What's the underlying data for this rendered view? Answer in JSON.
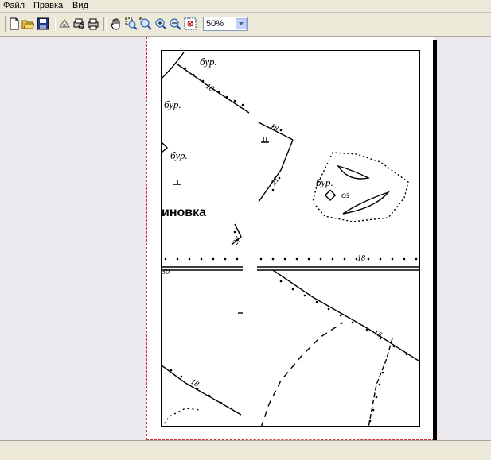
{
  "menu": {
    "file": "Файл",
    "edit": "Правка",
    "view": "Вид"
  },
  "toolbar": {
    "zoom_value": "50%",
    "tools": [
      "new-document-icon",
      "open-folder-icon",
      "save-disk-icon",
      "scan-icon",
      "print-preview-icon",
      "print-icon",
      "pan-hand-icon",
      "zoom-area-icon",
      "zoom-fit-icon",
      "zoom-in-icon",
      "zoom-out-icon",
      "zoom-to-page-icon"
    ]
  },
  "map": {
    "labels": {
      "bur1": "бур.",
      "bur2": "бур.",
      "bur3": "бур.",
      "bur4": "бур.",
      "village": "иновка",
      "oz": "оз",
      "num18a": "18",
      "num18b": "18",
      "num21": "21",
      "num27": "27",
      "num18c": "18",
      "num18d": "18",
      "num18e": "18",
      "num30": "30"
    }
  },
  "status": {
    "text": ""
  },
  "colors": {
    "chrome": "#ece9d8",
    "workspace": "#ebe9ed",
    "page_border": "#d03030"
  }
}
